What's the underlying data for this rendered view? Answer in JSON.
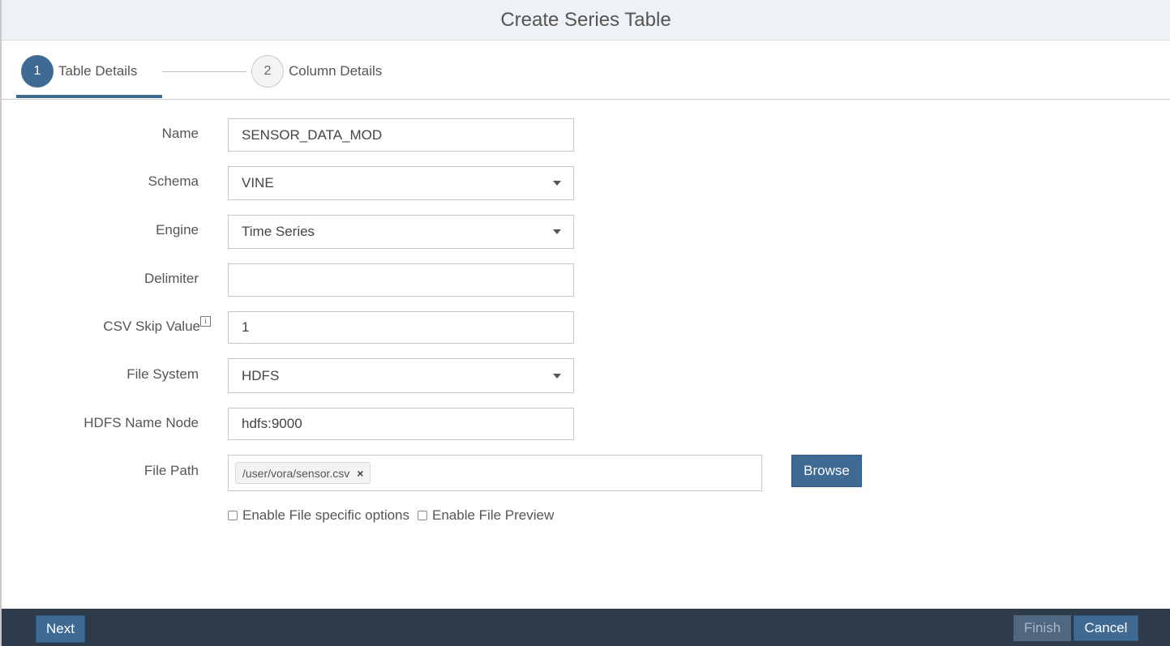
{
  "dialog": {
    "title": "Create Series Table"
  },
  "steps": [
    {
      "number": "1",
      "label": "Table Details",
      "active": true
    },
    {
      "number": "2",
      "label": "Column Details",
      "active": false
    }
  ],
  "form": {
    "name": {
      "label": "Name",
      "value": "SENSOR_DATA_MOD"
    },
    "schema": {
      "label": "Schema",
      "value": "VINE"
    },
    "engine": {
      "label": "Engine",
      "value": "Time Series"
    },
    "delimiter": {
      "label": "Delimiter",
      "value": ""
    },
    "csv_skip": {
      "label": "CSV Skip Value",
      "value": "1",
      "info_icon": "i"
    },
    "file_system": {
      "label": "File System",
      "value": "HDFS"
    },
    "hdfs_name_node": {
      "label": "HDFS Name Node",
      "value": "hdfs:9000"
    },
    "file_path": {
      "label": "File Path",
      "token": "/user/vora/sensor.csv",
      "remove_symbol": "×"
    },
    "browse_label": "Browse",
    "options": {
      "file_specific": "Enable File specific options",
      "file_preview": "Enable File Preview"
    }
  },
  "footer": {
    "next_label": "Next",
    "finish_label": "Finish",
    "cancel_label": "Cancel"
  },
  "colors": {
    "primary": "#3e6a94",
    "footer_bg": "#2e3b4a",
    "header_bg": "#eef2f5"
  }
}
